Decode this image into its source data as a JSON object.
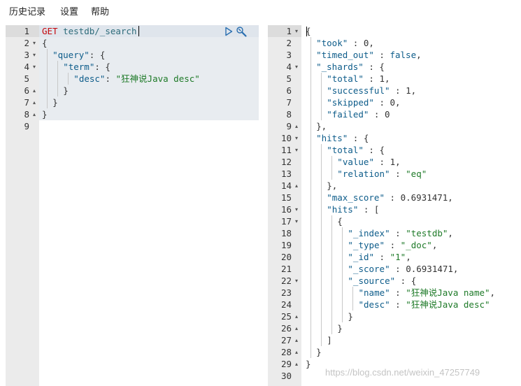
{
  "menu": {
    "history": "历史记录",
    "settings": "设置",
    "help": "帮助"
  },
  "request": {
    "lines": [
      {
        "num": "1",
        "fold": "",
        "indent": 0,
        "parts": [
          {
            "t": "GET ",
            "c": "method"
          },
          {
            "t": "testdb/_search",
            "c": "url"
          }
        ]
      },
      {
        "num": "2",
        "fold": "▾",
        "indent": 0,
        "parts": [
          {
            "t": "{",
            "c": "punct"
          }
        ]
      },
      {
        "num": "3",
        "fold": "▾",
        "indent": 2,
        "parts": [
          {
            "t": "\"query\"",
            "c": "key"
          },
          {
            "t": ": {",
            "c": "punct"
          }
        ]
      },
      {
        "num": "4",
        "fold": "▾",
        "indent": 4,
        "parts": [
          {
            "t": "\"term\"",
            "c": "key"
          },
          {
            "t": ": {",
            "c": "punct"
          }
        ]
      },
      {
        "num": "5",
        "fold": "",
        "indent": 6,
        "parts": [
          {
            "t": "\"desc\"",
            "c": "key"
          },
          {
            "t": ": ",
            "c": "punct"
          },
          {
            "t": "\"狂神说Java desc\"",
            "c": "str"
          }
        ]
      },
      {
        "num": "6",
        "fold": "▴",
        "indent": 4,
        "parts": [
          {
            "t": "}",
            "c": "punct"
          }
        ]
      },
      {
        "num": "7",
        "fold": "▴",
        "indent": 2,
        "parts": [
          {
            "t": "}",
            "c": "punct"
          }
        ]
      },
      {
        "num": "8",
        "fold": "▴",
        "indent": 0,
        "parts": [
          {
            "t": "}",
            "c": "punct"
          }
        ]
      },
      {
        "num": "9",
        "fold": "",
        "indent": 0,
        "parts": []
      }
    ]
  },
  "response": {
    "lines": [
      {
        "num": "1",
        "fold": "▾",
        "indent": 0,
        "parts": [
          {
            "t": "{",
            "c": "punct"
          }
        ]
      },
      {
        "num": "2",
        "fold": "",
        "indent": 2,
        "parts": [
          {
            "t": "\"took\"",
            "c": "key"
          },
          {
            "t": " : ",
            "c": "punct"
          },
          {
            "t": "0",
            "c": "num"
          },
          {
            "t": ",",
            "c": "punct"
          }
        ]
      },
      {
        "num": "3",
        "fold": "",
        "indent": 2,
        "parts": [
          {
            "t": "\"timed_out\"",
            "c": "key"
          },
          {
            "t": " : ",
            "c": "punct"
          },
          {
            "t": "false",
            "c": "bool"
          },
          {
            "t": ",",
            "c": "punct"
          }
        ]
      },
      {
        "num": "4",
        "fold": "▾",
        "indent": 2,
        "parts": [
          {
            "t": "\"_shards\"",
            "c": "key"
          },
          {
            "t": " : {",
            "c": "punct"
          }
        ]
      },
      {
        "num": "5",
        "fold": "",
        "indent": 4,
        "parts": [
          {
            "t": "\"total\"",
            "c": "key"
          },
          {
            "t": " : ",
            "c": "punct"
          },
          {
            "t": "1",
            "c": "num"
          },
          {
            "t": ",",
            "c": "punct"
          }
        ]
      },
      {
        "num": "6",
        "fold": "",
        "indent": 4,
        "parts": [
          {
            "t": "\"successful\"",
            "c": "key"
          },
          {
            "t": " : ",
            "c": "punct"
          },
          {
            "t": "1",
            "c": "num"
          },
          {
            "t": ",",
            "c": "punct"
          }
        ]
      },
      {
        "num": "7",
        "fold": "",
        "indent": 4,
        "parts": [
          {
            "t": "\"skipped\"",
            "c": "key"
          },
          {
            "t": " : ",
            "c": "punct"
          },
          {
            "t": "0",
            "c": "num"
          },
          {
            "t": ",",
            "c": "punct"
          }
        ]
      },
      {
        "num": "8",
        "fold": "",
        "indent": 4,
        "parts": [
          {
            "t": "\"failed\"",
            "c": "key"
          },
          {
            "t": " : ",
            "c": "punct"
          },
          {
            "t": "0",
            "c": "num"
          }
        ]
      },
      {
        "num": "9",
        "fold": "▴",
        "indent": 2,
        "parts": [
          {
            "t": "},",
            "c": "punct"
          }
        ]
      },
      {
        "num": "10",
        "fold": "▾",
        "indent": 2,
        "parts": [
          {
            "t": "\"hits\"",
            "c": "key"
          },
          {
            "t": " : {",
            "c": "punct"
          }
        ]
      },
      {
        "num": "11",
        "fold": "▾",
        "indent": 4,
        "parts": [
          {
            "t": "\"total\"",
            "c": "key"
          },
          {
            "t": " : {",
            "c": "punct"
          }
        ]
      },
      {
        "num": "12",
        "fold": "",
        "indent": 6,
        "parts": [
          {
            "t": "\"value\"",
            "c": "key"
          },
          {
            "t": " : ",
            "c": "punct"
          },
          {
            "t": "1",
            "c": "num"
          },
          {
            "t": ",",
            "c": "punct"
          }
        ]
      },
      {
        "num": "13",
        "fold": "",
        "indent": 6,
        "parts": [
          {
            "t": "\"relation\"",
            "c": "key"
          },
          {
            "t": " : ",
            "c": "punct"
          },
          {
            "t": "\"eq\"",
            "c": "str"
          }
        ]
      },
      {
        "num": "14",
        "fold": "▴",
        "indent": 4,
        "parts": [
          {
            "t": "},",
            "c": "punct"
          }
        ]
      },
      {
        "num": "15",
        "fold": "",
        "indent": 4,
        "parts": [
          {
            "t": "\"max_score\"",
            "c": "key"
          },
          {
            "t": " : ",
            "c": "punct"
          },
          {
            "t": "0.6931471",
            "c": "num"
          },
          {
            "t": ",",
            "c": "punct"
          }
        ]
      },
      {
        "num": "16",
        "fold": "▾",
        "indent": 4,
        "parts": [
          {
            "t": "\"hits\"",
            "c": "key"
          },
          {
            "t": " : [",
            "c": "punct"
          }
        ]
      },
      {
        "num": "17",
        "fold": "▾",
        "indent": 6,
        "parts": [
          {
            "t": "{",
            "c": "punct"
          }
        ]
      },
      {
        "num": "18",
        "fold": "",
        "indent": 8,
        "parts": [
          {
            "t": "\"_index\"",
            "c": "key"
          },
          {
            "t": " : ",
            "c": "punct"
          },
          {
            "t": "\"testdb\"",
            "c": "str"
          },
          {
            "t": ",",
            "c": "punct"
          }
        ]
      },
      {
        "num": "19",
        "fold": "",
        "indent": 8,
        "parts": [
          {
            "t": "\"_type\"",
            "c": "key"
          },
          {
            "t": " : ",
            "c": "punct"
          },
          {
            "t": "\"_doc\"",
            "c": "str"
          },
          {
            "t": ",",
            "c": "punct"
          }
        ]
      },
      {
        "num": "20",
        "fold": "",
        "indent": 8,
        "parts": [
          {
            "t": "\"_id\"",
            "c": "key"
          },
          {
            "t": " : ",
            "c": "punct"
          },
          {
            "t": "\"1\"",
            "c": "str"
          },
          {
            "t": ",",
            "c": "punct"
          }
        ]
      },
      {
        "num": "21",
        "fold": "",
        "indent": 8,
        "parts": [
          {
            "t": "\"_score\"",
            "c": "key"
          },
          {
            "t": " : ",
            "c": "punct"
          },
          {
            "t": "0.6931471",
            "c": "num"
          },
          {
            "t": ",",
            "c": "punct"
          }
        ]
      },
      {
        "num": "22",
        "fold": "▾",
        "indent": 8,
        "parts": [
          {
            "t": "\"_source\"",
            "c": "key"
          },
          {
            "t": " : {",
            "c": "punct"
          }
        ]
      },
      {
        "num": "23",
        "fold": "",
        "indent": 10,
        "parts": [
          {
            "t": "\"name\"",
            "c": "key"
          },
          {
            "t": " : ",
            "c": "punct"
          },
          {
            "t": "\"狂神说Java name\"",
            "c": "str"
          },
          {
            "t": ",",
            "c": "punct"
          }
        ]
      },
      {
        "num": "24",
        "fold": "",
        "indent": 10,
        "parts": [
          {
            "t": "\"desc\"",
            "c": "key"
          },
          {
            "t": " : ",
            "c": "punct"
          },
          {
            "t": "\"狂神说Java desc\"",
            "c": "str"
          }
        ]
      },
      {
        "num": "25",
        "fold": "▴",
        "indent": 8,
        "parts": [
          {
            "t": "}",
            "c": "punct"
          }
        ]
      },
      {
        "num": "26",
        "fold": "▴",
        "indent": 6,
        "parts": [
          {
            "t": "}",
            "c": "punct"
          }
        ]
      },
      {
        "num": "27",
        "fold": "▴",
        "indent": 4,
        "parts": [
          {
            "t": "]",
            "c": "punct"
          }
        ]
      },
      {
        "num": "28",
        "fold": "▴",
        "indent": 2,
        "parts": [
          {
            "t": "}",
            "c": "punct"
          }
        ]
      },
      {
        "num": "29",
        "fold": "▴",
        "indent": 0,
        "parts": [
          {
            "t": "}",
            "c": "punct"
          }
        ]
      },
      {
        "num": "30",
        "fold": "",
        "indent": 0,
        "parts": []
      }
    ]
  },
  "icons": {
    "run": "play-icon",
    "settings": "wrench-icon"
  },
  "colors": {
    "method": "#c5060b",
    "key": "#0d5c8a",
    "string": "#1e7a28",
    "gutter": "#ebebeb",
    "selection": "#e8ecf0"
  },
  "watermark": "https://blog.csdn.net/weixin_47257749"
}
